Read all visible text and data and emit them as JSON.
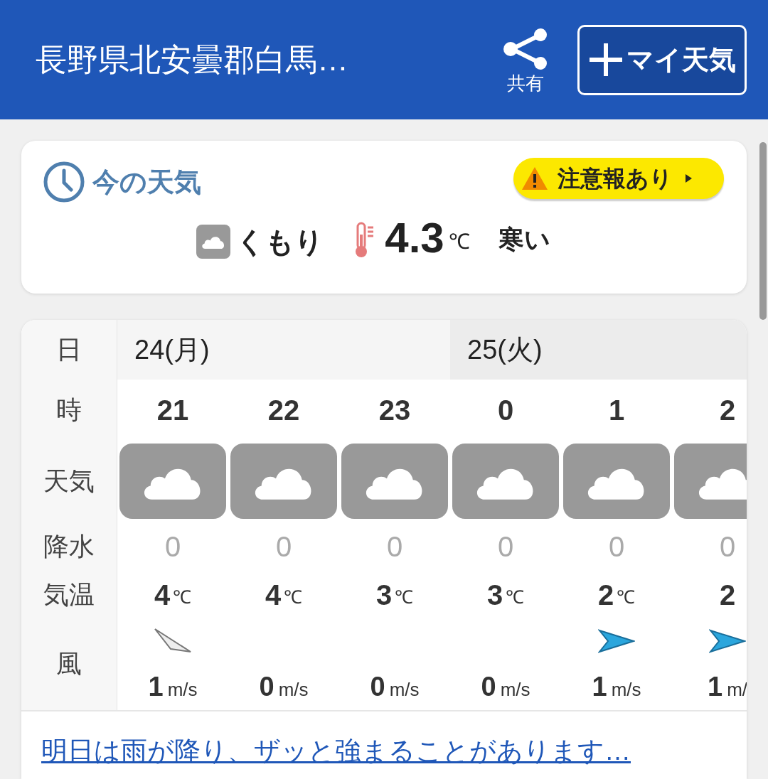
{
  "header": {
    "title": "長野県北安曇郡白馬…",
    "share_label": "共有",
    "add_button": "マイ天気"
  },
  "current": {
    "heading": "今の天気",
    "alert": "注意報あり",
    "condition": "くもり",
    "temperature": "4.3",
    "temp_unit": "℃",
    "feel": "寒い"
  },
  "forecast": {
    "labels": {
      "date": "日",
      "hour": "時",
      "weather": "天気",
      "precip": "降水",
      "temp": "気温",
      "wind": "風"
    },
    "dates": [
      {
        "label": "24(月)",
        "kind": "today"
      },
      {
        "label": "25(火)",
        "kind": "tomorrow"
      }
    ],
    "hours": [
      {
        "hour": "21",
        "precip": "0",
        "temp": "4",
        "temp_unit": "℃",
        "wind": {
          "kind": "weak"
        },
        "speed": "1",
        "speed_unit": "m/s"
      },
      {
        "hour": "22",
        "precip": "0",
        "temp": "4",
        "temp_unit": "℃",
        "wind": {
          "kind": "none"
        },
        "speed": "0",
        "speed_unit": "m/s"
      },
      {
        "hour": "23",
        "precip": "0",
        "temp": "3",
        "temp_unit": "℃",
        "wind": {
          "kind": "none"
        },
        "speed": "0",
        "speed_unit": "m/s"
      },
      {
        "hour": "0",
        "precip": "0",
        "temp": "3",
        "temp_unit": "℃",
        "wind": {
          "kind": "none"
        },
        "speed": "0",
        "speed_unit": "m/s"
      },
      {
        "hour": "1",
        "precip": "0",
        "temp": "2",
        "temp_unit": "℃",
        "wind": {
          "kind": "arrow"
        },
        "speed": "1",
        "speed_unit": "m/s"
      },
      {
        "hour": "2",
        "precip": "0",
        "temp": "2",
        "wind": {
          "kind": "arrow"
        },
        "speed": "1",
        "speed_unit": "m/"
      }
    ],
    "summary_link": "明日は雨が降り、ザッと強まることがあります…"
  }
}
